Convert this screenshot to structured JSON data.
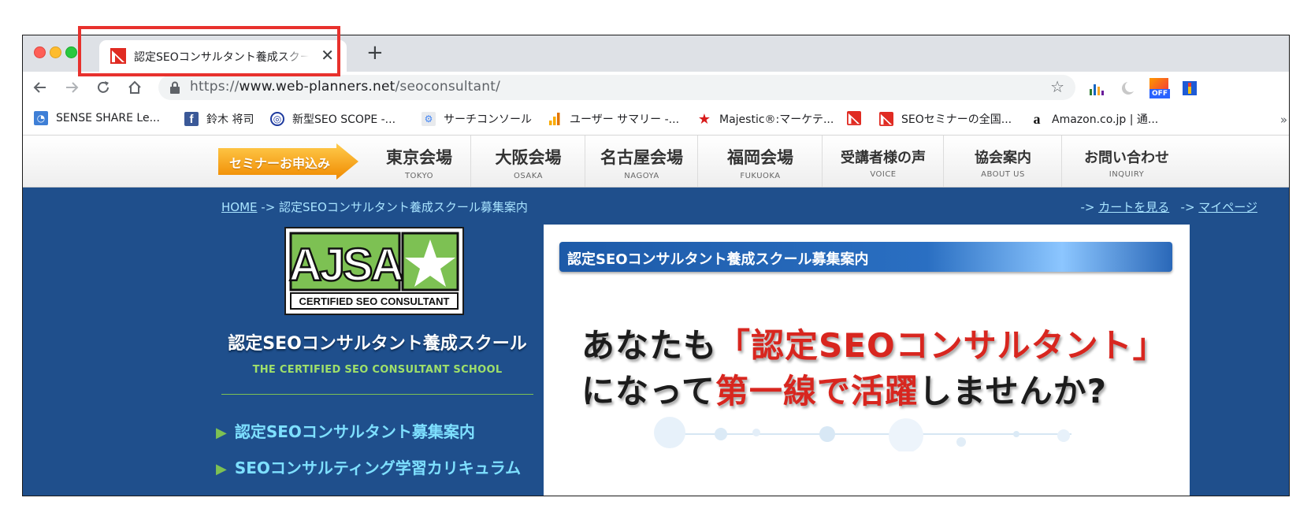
{
  "browser": {
    "tab": {
      "title": "認定SEOコンサルタント養成スクール募集案内",
      "close": "✕"
    },
    "new_tab": "+",
    "address": {
      "scheme": "https://",
      "host": "www.web-planners.net",
      "path": "/seoconsultant/"
    },
    "extension_badge": "OFF",
    "bookmarks": [
      {
        "label": "SENSE SHARE Le...",
        "icon": "rss-icon"
      },
      {
        "label": "鈴木 将司",
        "icon": "facebook-icon"
      },
      {
        "label": "新型SEO SCOPE -...",
        "icon": "scope-icon"
      },
      {
        "label": "サーチコンソール",
        "icon": "search-console-icon"
      },
      {
        "label": "ユーザー サマリー -...",
        "icon": "analytics-icon"
      },
      {
        "label": "Majestic®:マーケテ...",
        "icon": "majestic-star-icon"
      },
      {
        "label": "",
        "icon": "web-planners-icon"
      },
      {
        "label": "SEOセミナーの全国...",
        "icon": "web-planners-icon"
      },
      {
        "label": "Amazon.co.jp | 通...",
        "icon": "amazon-icon"
      }
    ],
    "bookmarks_more": "»"
  },
  "site": {
    "cta": "セミナーお申込み",
    "nav": [
      {
        "jp": "東京会場",
        "en": "TOKYO"
      },
      {
        "jp": "大阪会場",
        "en": "OSAKA"
      },
      {
        "jp": "名古屋会場",
        "en": "NAGOYA"
      },
      {
        "jp": "福岡会場",
        "en": "FUKUOKA"
      },
      {
        "jp": "受講者様の声",
        "en": "VOICE"
      },
      {
        "jp": "協会案内",
        "en": "ABOUT US"
      },
      {
        "jp": "お問い合わせ",
        "en": "INQUIRY"
      }
    ],
    "breadcrumb": {
      "home": "HOME",
      "sep": " -> ",
      "current": "認定SEOコンサルタント養成スクール募集案内"
    },
    "top_links": [
      {
        "prefix": "-> ",
        "label": "カートを見る"
      },
      {
        "prefix": "-> ",
        "label": "マイページ"
      }
    ],
    "logo": {
      "text": "AJSA",
      "caption": "CERTIFIED SEO CONSULTANT"
    },
    "sidebar": {
      "title": "認定SEOコンサルタント養成スクール",
      "subtitle": "THE CERTIFIED SEO CONSULTANT SCHOOL",
      "links": [
        "認定SEOコンサルタント募集案内",
        "SEOコンサルティング学習カリキュラム"
      ]
    },
    "panel": {
      "heading": "認定SEOコンサルタント養成スクール募集案内",
      "hero_line1": {
        "a": "あなたも",
        "b": "「認定SEOコンサルタント」"
      },
      "hero_line2": {
        "a": "になって",
        "b": "第一線で活躍",
        "c": "しませんか?"
      }
    }
  },
  "colors": {
    "highlight": "#e8312d",
    "site_blue": "#1f4f8c",
    "accent_red": "#d8261f",
    "cta_orange": "#f5a623",
    "link_cyan": "#7ee0ff"
  }
}
